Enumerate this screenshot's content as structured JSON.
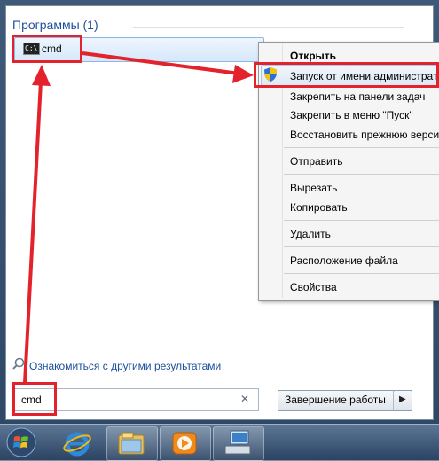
{
  "programs": {
    "header": "Программы (1)",
    "items": [
      {
        "label": "cmd",
        "icon_text": "C:\\"
      }
    ]
  },
  "context_menu": {
    "items": [
      "Открыть",
      "Запуск от имени администратора",
      "Закрепить на панели задач",
      "Закрепить в меню \"Пуск\"",
      "Восстановить прежнюю версию",
      "Отправить",
      "Вырезать",
      "Копировать",
      "Удалить",
      "Расположение файла",
      "Свойства"
    ]
  },
  "see_more": {
    "label": "Ознакомиться с другими результатами"
  },
  "search": {
    "value": "cmd",
    "clear": "✕"
  },
  "shutdown": {
    "label": "Завершение работы",
    "arrow": "▶"
  },
  "colors": {
    "annotation": "#e3222b",
    "header_blue": "#1e4f9a"
  },
  "taskbar": {
    "icons": [
      "start-orb",
      "internet-explorer",
      "windows-explorer",
      "media-player",
      "network-computer"
    ]
  }
}
